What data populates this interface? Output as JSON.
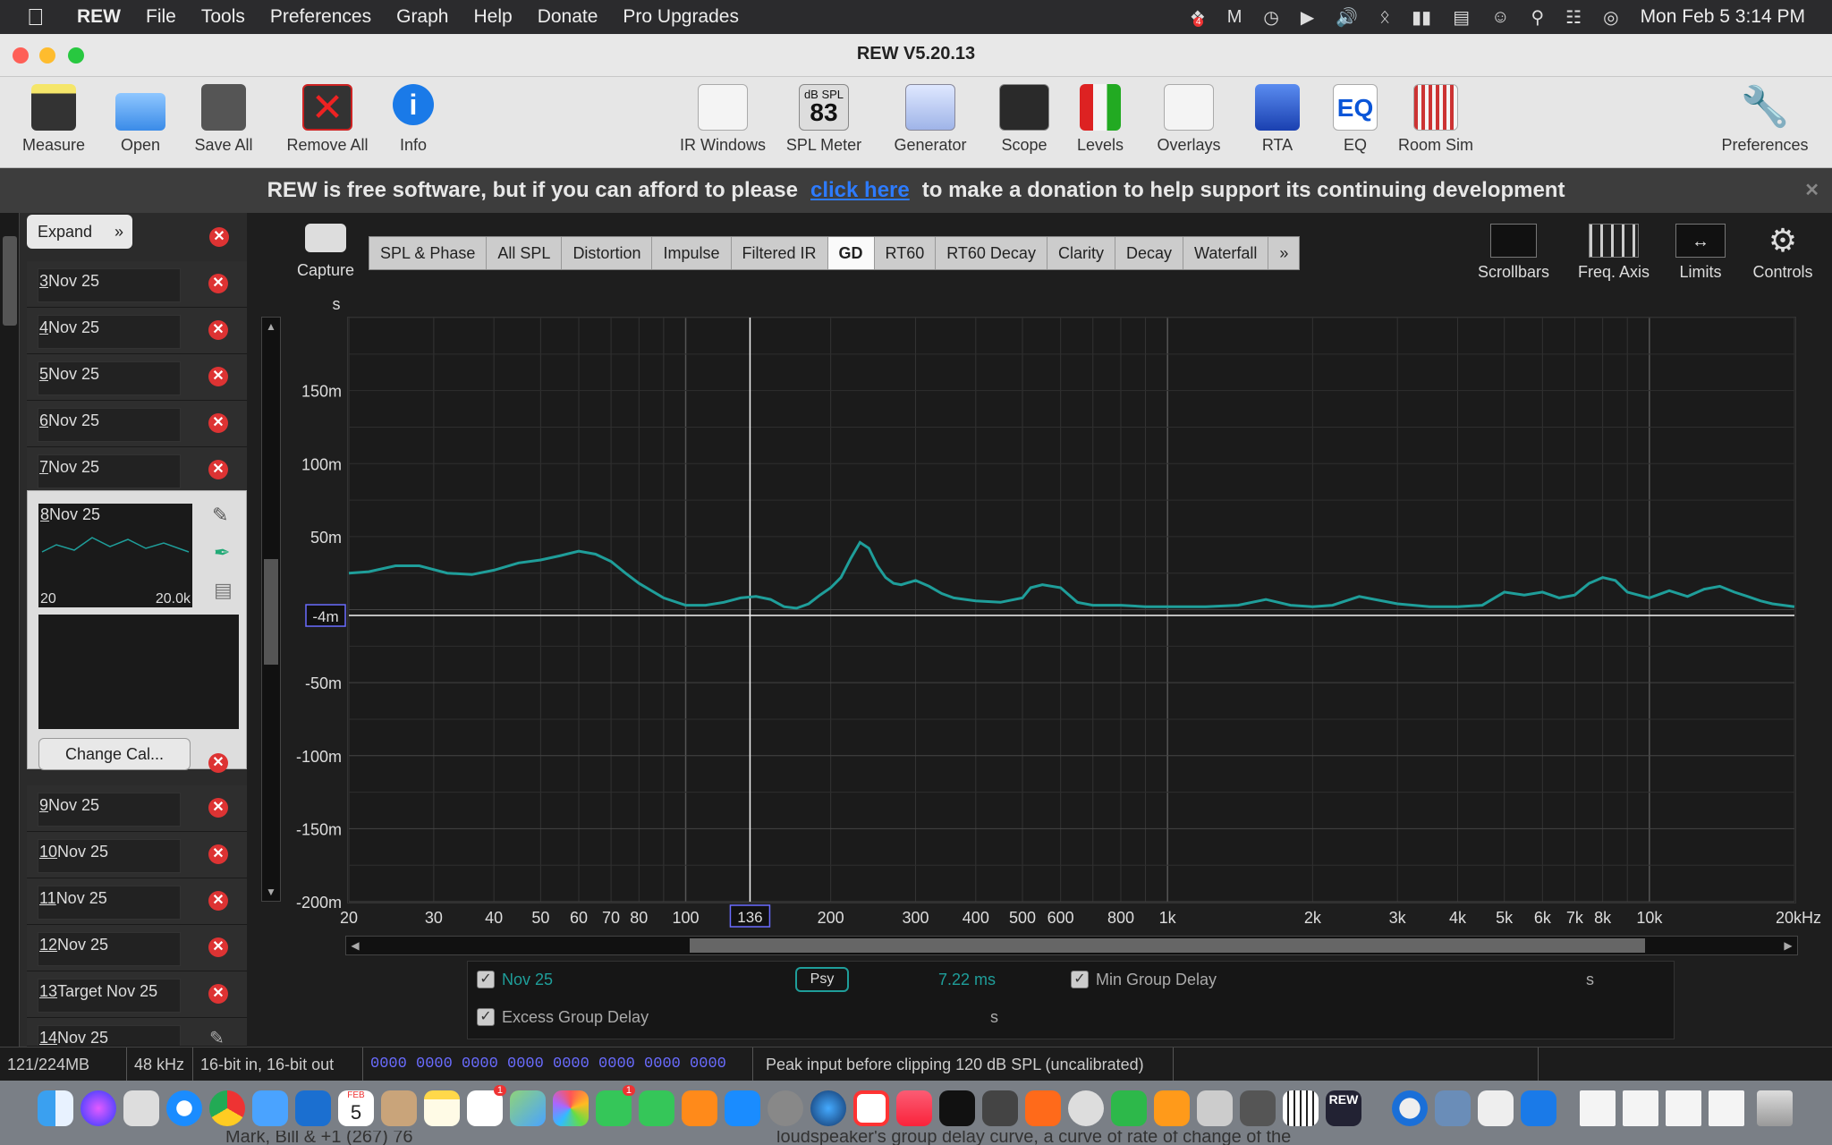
{
  "menubar": {
    "app": "REW",
    "items": [
      "File",
      "Tools",
      "Preferences",
      "Graph",
      "Help",
      "Donate",
      "Pro Upgrades"
    ],
    "clock": "Mon Feb 5  3:14 PM",
    "badge": "4"
  },
  "window": {
    "title": "REW V5.20.13"
  },
  "toolbar": {
    "left": [
      "Measure",
      "Open",
      "Save All",
      "Remove All",
      "Info"
    ],
    "center": [
      "IR Windows",
      "SPL Meter",
      "Generator",
      "Scope",
      "Levels",
      "Overlays",
      "RTA",
      "EQ",
      "Room Sim"
    ],
    "right": "Preferences",
    "spl_label": "dB SPL",
    "spl_value": "83",
    "eq_label": "EQ"
  },
  "banner": {
    "text_before": "REW is free software, but if you can afford to please",
    "link": "click here",
    "text_after": "to make a donation to help support its continuing development"
  },
  "left_panel": {
    "expand": "Expand",
    "measurements": [
      {
        "num": "3",
        "name": "Nov 25"
      },
      {
        "num": "4",
        "name": "Nov 25"
      },
      {
        "num": "5",
        "name": "Nov 25"
      },
      {
        "num": "6",
        "name": "Nov 25"
      },
      {
        "num": "7",
        "name": "Nov 25"
      }
    ],
    "selected": {
      "num": "8",
      "name": "Nov 25",
      "fmin": "20",
      "fmax": "20.0k",
      "cal_button": "Change Cal..."
    },
    "measurements_below": [
      {
        "num": "9",
        "name": "Nov 25"
      },
      {
        "num": "10",
        "name": "Nov 25"
      },
      {
        "num": "11",
        "name": "Nov 25"
      },
      {
        "num": "12",
        "name": "Nov 25"
      },
      {
        "num": "13",
        "name": "Target Nov 25"
      },
      {
        "num": "14",
        "name": "Nov 25"
      }
    ]
  },
  "graph_controls": {
    "capture": "Capture",
    "tabs": [
      "SPL & Phase",
      "All SPL",
      "Distortion",
      "Impulse",
      "Filtered IR",
      "GD",
      "RT60",
      "RT60 Decay",
      "Clarity",
      "Decay",
      "Waterfall"
    ],
    "active_tab": "GD",
    "more": "»",
    "right_buttons": [
      "Scrollbars",
      "Freq. Axis",
      "Limits",
      "Controls"
    ]
  },
  "chart_data": {
    "type": "line",
    "ylabel": "s",
    "xscale": "log",
    "xlim": [
      20,
      20000
    ],
    "ylim": [
      -0.2,
      0.2
    ],
    "yticks": [
      {
        "v": 0.15,
        "label": "150m"
      },
      {
        "v": 0.1,
        "label": "100m"
      },
      {
        "v": 0.05,
        "label": "50m"
      },
      {
        "v": -0.05,
        "label": "-50m"
      },
      {
        "v": -0.1,
        "label": "-100m"
      },
      {
        "v": -0.15,
        "label": "-150m"
      },
      {
        "v": -0.2,
        "label": "-200m"
      }
    ],
    "xticks": [
      {
        "v": 20,
        "label": "20"
      },
      {
        "v": 30,
        "label": "30"
      },
      {
        "v": 40,
        "label": "40"
      },
      {
        "v": 50,
        "label": "50"
      },
      {
        "v": 60,
        "label": "60"
      },
      {
        "v": 70,
        "label": "70"
      },
      {
        "v": 80,
        "label": "80"
      },
      {
        "v": 100,
        "label": "100"
      },
      {
        "v": 200,
        "label": "200"
      },
      {
        "v": 300,
        "label": "300"
      },
      {
        "v": 400,
        "label": "400"
      },
      {
        "v": 500,
        "label": "500"
      },
      {
        "v": 600,
        "label": "600"
      },
      {
        "v": 800,
        "label": "800"
      },
      {
        "v": 1000,
        "label": "1k"
      },
      {
        "v": 2000,
        "label": "2k"
      },
      {
        "v": 3000,
        "label": "3k"
      },
      {
        "v": 4000,
        "label": "4k"
      },
      {
        "v": 5000,
        "label": "5k"
      },
      {
        "v": 6000,
        "label": "6k"
      },
      {
        "v": 7000,
        "label": "7k"
      },
      {
        "v": 8000,
        "label": "8k"
      },
      {
        "v": 10000,
        "label": "10k"
      },
      {
        "v": 20000,
        "label": "20kHz"
      }
    ],
    "cursor": {
      "x": 136,
      "x_label": "136",
      "y": -0.004,
      "y_label": "-4m"
    },
    "series": [
      {
        "name": "Nov 25",
        "color": "#1f9e9a",
        "x": [
          20,
          22,
          25,
          28,
          32,
          36,
          40,
          45,
          50,
          55,
          60,
          65,
          70,
          75,
          80,
          90,
          100,
          110,
          120,
          130,
          140,
          150,
          160,
          170,
          180,
          190,
          200,
          210,
          220,
          230,
          240,
          250,
          260,
          270,
          280,
          300,
          320,
          340,
          360,
          400,
          450,
          500,
          520,
          550,
          600,
          650,
          700,
          800,
          900,
          1000,
          1200,
          1400,
          1600,
          1800,
          2000,
          2200,
          2500,
          3000,
          3500,
          4000,
          4500,
          5000,
          5500,
          6000,
          6500,
          7000,
          7500,
          8000,
          8500,
          9000,
          10000,
          11000,
          12000,
          13000,
          14000,
          15000,
          16000,
          17000,
          18000,
          20000
        ],
        "y": [
          0.025,
          0.026,
          0.03,
          0.03,
          0.025,
          0.024,
          0.027,
          0.032,
          0.034,
          0.037,
          0.04,
          0.038,
          0.033,
          0.025,
          0.018,
          0.008,
          0.003,
          0.003,
          0.005,
          0.008,
          0.009,
          0.007,
          0.002,
          0.001,
          0.004,
          0.01,
          0.015,
          0.022,
          0.035,
          0.046,
          0.042,
          0.03,
          0.022,
          0.018,
          0.017,
          0.02,
          0.016,
          0.011,
          0.008,
          0.006,
          0.005,
          0.008,
          0.015,
          0.017,
          0.015,
          0.005,
          0.003,
          0.003,
          0.002,
          0.002,
          0.002,
          0.003,
          0.007,
          0.003,
          0.002,
          0.003,
          0.009,
          0.004,
          0.002,
          0.002,
          0.003,
          0.012,
          0.01,
          0.012,
          0.008,
          0.01,
          0.018,
          0.022,
          0.02,
          0.012,
          0.008,
          0.013,
          0.009,
          0.014,
          0.016,
          0.012,
          0.009,
          0.006,
          0.004,
          0.002
        ]
      }
    ]
  },
  "legend": {
    "row1_name": "Nov 25",
    "smoothing": "Psy",
    "value": "7.22 ms",
    "min_gd": "Min Group Delay",
    "min_gd_unit": "s",
    "excess_gd": "Excess Group Delay",
    "excess_gd_unit": "s"
  },
  "statusbar": {
    "memory": "121/224MB",
    "rate": "48 kHz",
    "bits": "16-bit in, 16-bit out",
    "levels": "0000 0000  0000 0000  0000 0000  0000 0000",
    "peak": "Peak input before clipping 120 dB SPL (uncalibrated)"
  },
  "dock": {
    "rew_label": "REW",
    "calendar_month": "FEB",
    "calendar_day": "5",
    "badge1": "1",
    "badge2": "1"
  },
  "partial_text": {
    "left": "Mark, Bill & +1 (267) 76",
    "right": "loudspeaker's group delay curve, a curve of rate of change of the"
  },
  "colors": {
    "accent_link": "#2d7bff",
    "trace": "#1f9e9a",
    "close_red": "#d33"
  }
}
